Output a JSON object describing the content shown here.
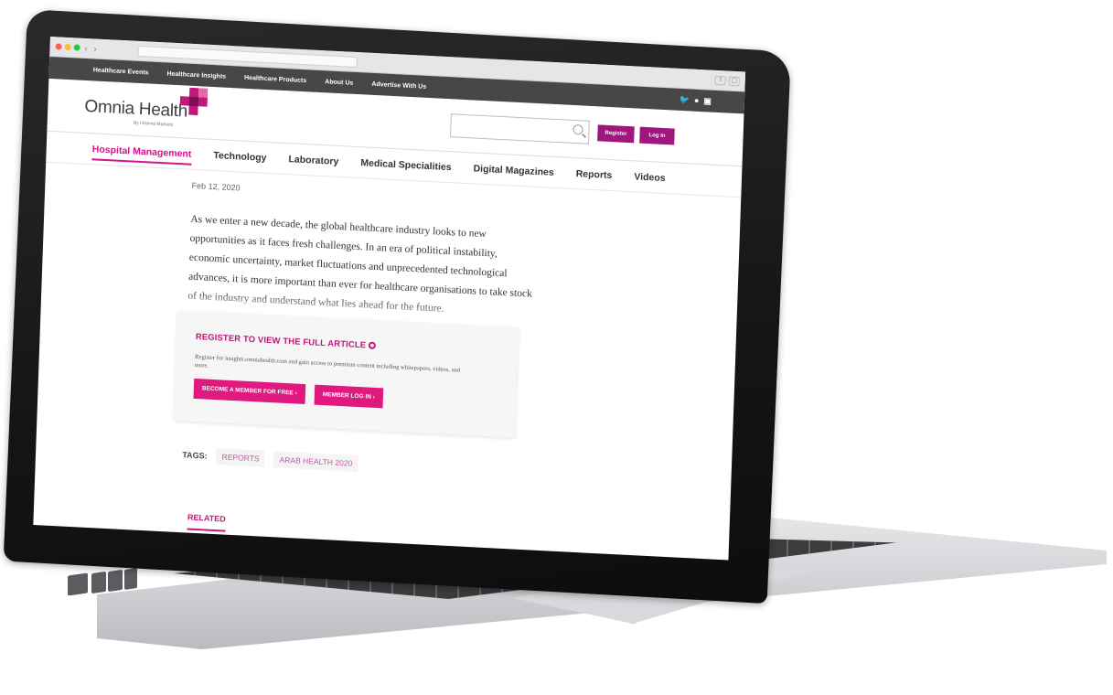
{
  "browser": {
    "traffic_lights": [
      "#ff5f57",
      "#febc2e",
      "#28c840"
    ],
    "back_label": "‹",
    "forward_label": "›"
  },
  "topnav": {
    "items": [
      "Healthcare Events",
      "Healthcare Insights",
      "Healthcare Products",
      "About Us",
      "Advertise With Us"
    ],
    "social_icons": [
      "twitter-icon",
      "facebook-icon",
      "linkedin-icon"
    ],
    "social_glyphs": [
      "♥",
      "f",
      "in"
    ]
  },
  "header": {
    "logo_text": "Omnia Health",
    "logo_sub": "By Informa Markets",
    "search_placeholder": "",
    "register_label": "Register",
    "login_label": "Log In",
    "brand_color": "#a0157e"
  },
  "mainnav": {
    "items": [
      "Hospital Management",
      "Technology",
      "Laboratory",
      "Medical Specialities",
      "Digital Magazines",
      "Reports",
      "Videos"
    ],
    "active_index": 0,
    "accent_color": "#d4148a"
  },
  "article": {
    "date": "Feb 12, 2020",
    "body": "As we enter a new decade, the global healthcare industry looks to new opportunities as it faces fresh challenges. In an era of political instability, economic uncertainty, market fluctuations and unprecedented technological advances, it is more important than ever for healthcare organisations to take stock of the industry and understand what lies ahead for the future."
  },
  "gate": {
    "title": "REGISTER TO VIEW THE FULL ARTICLE",
    "description": "Register for insights.omniahealth.com and gain access to premium content including whitepapers, videos, and more.",
    "member_free_label": "BECOME A MEMBER FOR FREE  ›",
    "member_login_label": "MEMBER LOG IN  ›"
  },
  "tags": {
    "label": "TAGS:",
    "items": [
      "REPORTS",
      "ARAB HEALTH 2020"
    ]
  },
  "related": {
    "label": "RELATED"
  }
}
